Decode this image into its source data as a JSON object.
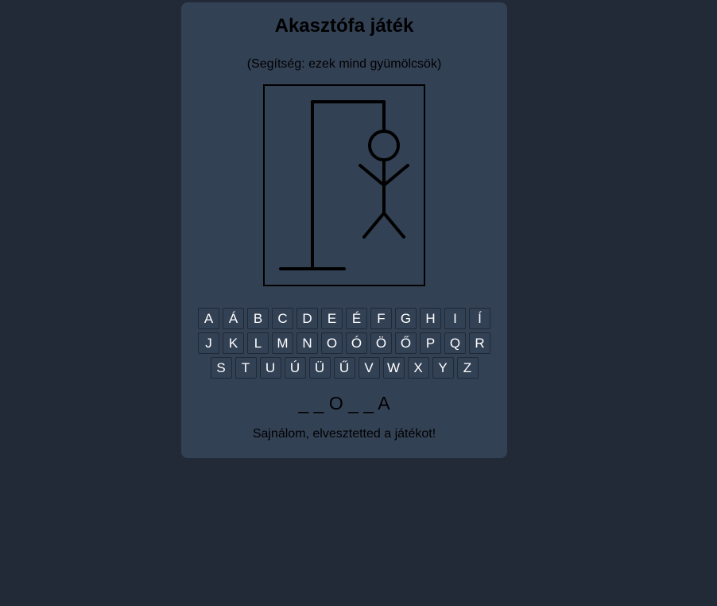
{
  "game": {
    "title": "Akasztófa játék",
    "hint": "(Segítség: ezek mind gyümölcsök)",
    "word_display": "_ _ O _ _ A",
    "status": "Sajnálom, elvesztetted a játékot!",
    "wrong_guesses": 6,
    "max_wrong_guesses": 6
  },
  "keyboard": {
    "rows": [
      [
        "A",
        "Á",
        "B",
        "C",
        "D",
        "E",
        "É",
        "F",
        "G",
        "H",
        "I",
        "Í"
      ],
      [
        "J",
        "K",
        "L",
        "M",
        "N",
        "O",
        "Ó",
        "Ö",
        "Ő",
        "P",
        "Q",
        "R"
      ],
      [
        "S",
        "T",
        "U",
        "Ú",
        "Ü",
        "Ű",
        "V",
        "W",
        "X",
        "Y",
        "Z"
      ]
    ]
  },
  "colors": {
    "background": "#222a38",
    "card": "#334155",
    "key_text": "#ffffff",
    "drawing": "#000000"
  }
}
